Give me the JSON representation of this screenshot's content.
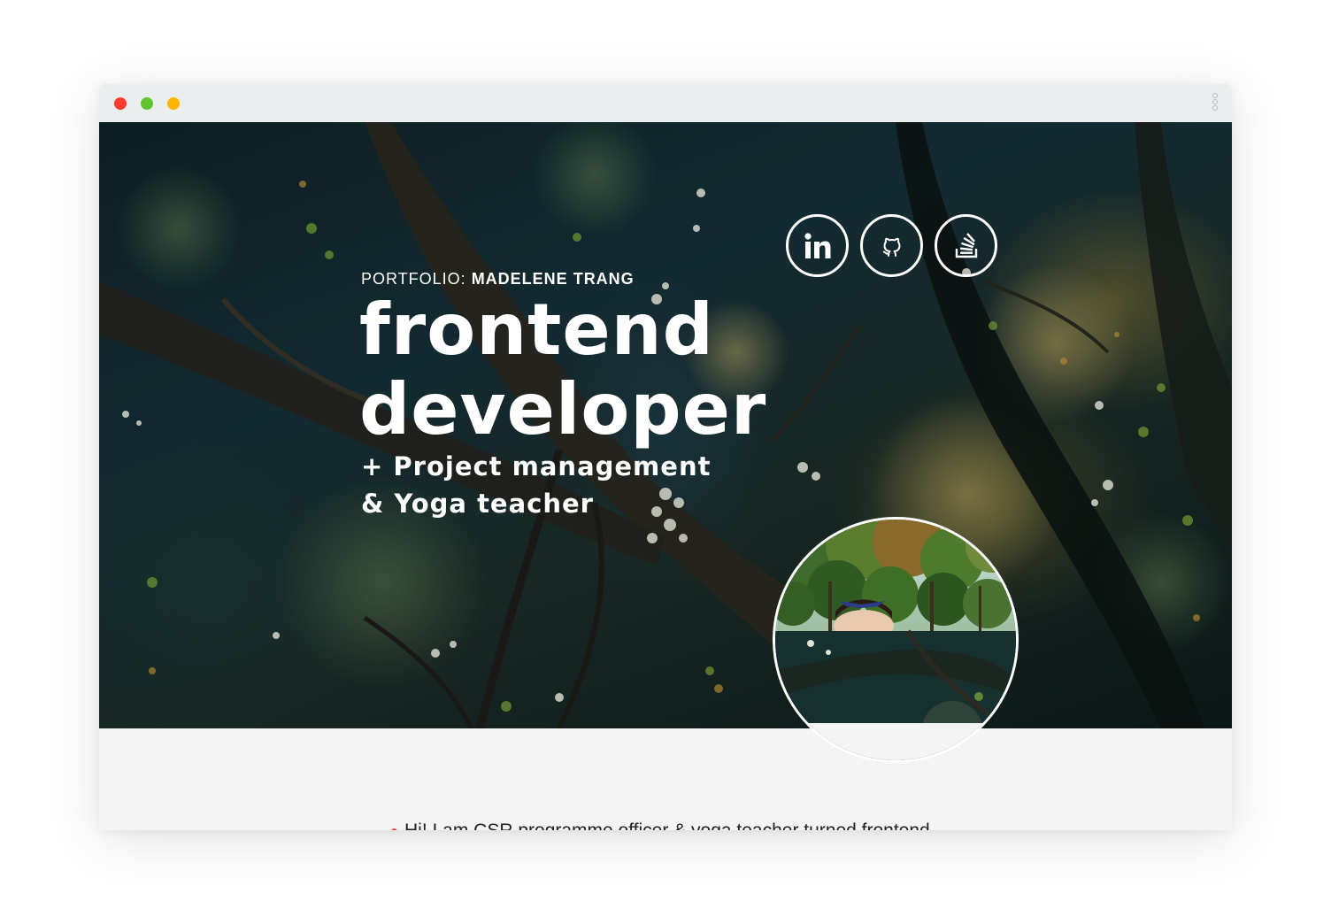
{
  "browser": {
    "controls": [
      "close",
      "minimize",
      "maximize"
    ],
    "menu_icon": "kebab-menu-icon"
  },
  "hero": {
    "eyebrow_prefix": "PORTFOLIO: ",
    "eyebrow_name": "MADELENE TRANG",
    "headline_line1": "frontend",
    "headline_line2": "developer",
    "subline_line1": "+ Project management",
    "subline_line2": "& Yoga teacher",
    "social": [
      {
        "name": "linkedin",
        "icon": "linkedin-icon"
      },
      {
        "name": "github",
        "icon": "github-icon"
      },
      {
        "name": "stackoverflow",
        "icon": "stackoverflow-icon"
      }
    ],
    "avatar": "profile-photo"
  },
  "intro": {
    "text": "Hi! I am CSR programme officer & yoga teacher turned frontend"
  },
  "colors": {
    "titlebar": "#ebeeee",
    "page_bg": "#f4f4f4",
    "hero_dark": "#16323a",
    "accent_red": "#e84a4a",
    "white": "#ffffff"
  }
}
